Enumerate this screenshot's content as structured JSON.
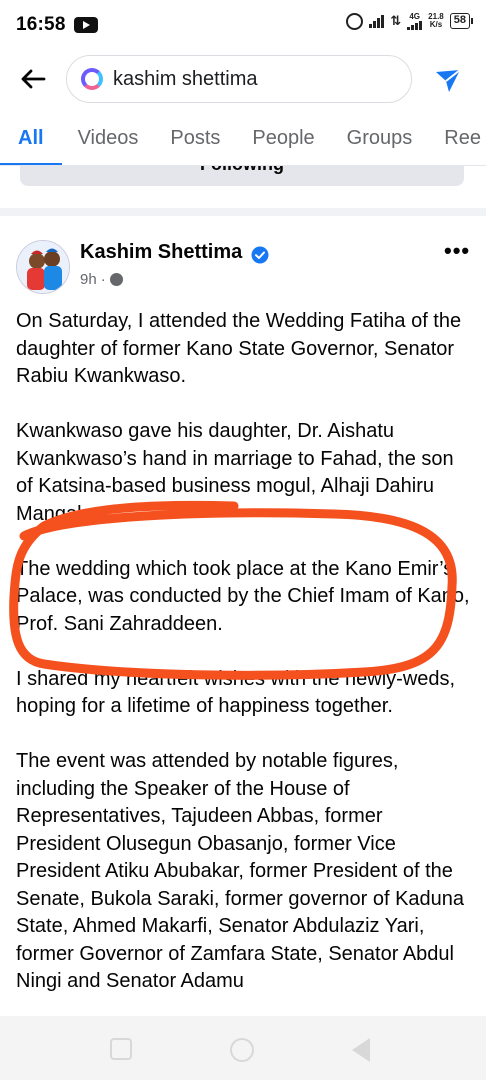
{
  "status_bar": {
    "time": "16:58",
    "network": "4G",
    "speed_value": "21.8",
    "speed_unit": "K/s",
    "battery": "58"
  },
  "search": {
    "query": "kashim shettima"
  },
  "tabs": [
    {
      "label": "All",
      "active": true
    },
    {
      "label": "Videos"
    },
    {
      "label": "Posts"
    },
    {
      "label": "People"
    },
    {
      "label": "Groups"
    },
    {
      "label": "Ree"
    }
  ],
  "following_card": {
    "label": "Following"
  },
  "post": {
    "author": "Kashim Shettima",
    "time": "9h",
    "paragraphs": [
      "On Saturday, I attended the Wedding Fatiha of the daughter of former Kano State Governor, Senator Rabiu Kwankwaso.",
      "Kwankwaso gave his daughter, Dr. Aishatu Kwankwaso’s hand in marriage to Fahad, the son of Katsina-based business mogul, Alhaji Dahiru Mangal.",
      "The wedding which took place at the Kano Emir’s Palace, was conducted by the Chief Imam of Kano, Prof. Sani Zahraddeen.",
      "I shared my heartfelt wishes with the newly-weds, hoping for a lifetime of happiness together.",
      "The event was attended by notable figures, including the Speaker of the House of Representatives, Tajudeen Abbas, former President Olusegun Obasanjo, former Vice President Atiku Abubakar, former President of the Senate, Bukola Saraki, former governor of Kaduna State, Ahmed Makarfi, Senator Abdulaziz Yari, former Governor of Zamfara State, Senator Abdul Ningi and Senator Adamu"
    ]
  },
  "colors": {
    "accent": "#1877f2",
    "annotation": "#f4511e",
    "secondary_text": "#65676b"
  },
  "icons": [
    "back-arrow-icon",
    "search-logo-icon",
    "filter-icon",
    "verified-badge-icon",
    "globe-icon",
    "more-options-icon"
  ]
}
